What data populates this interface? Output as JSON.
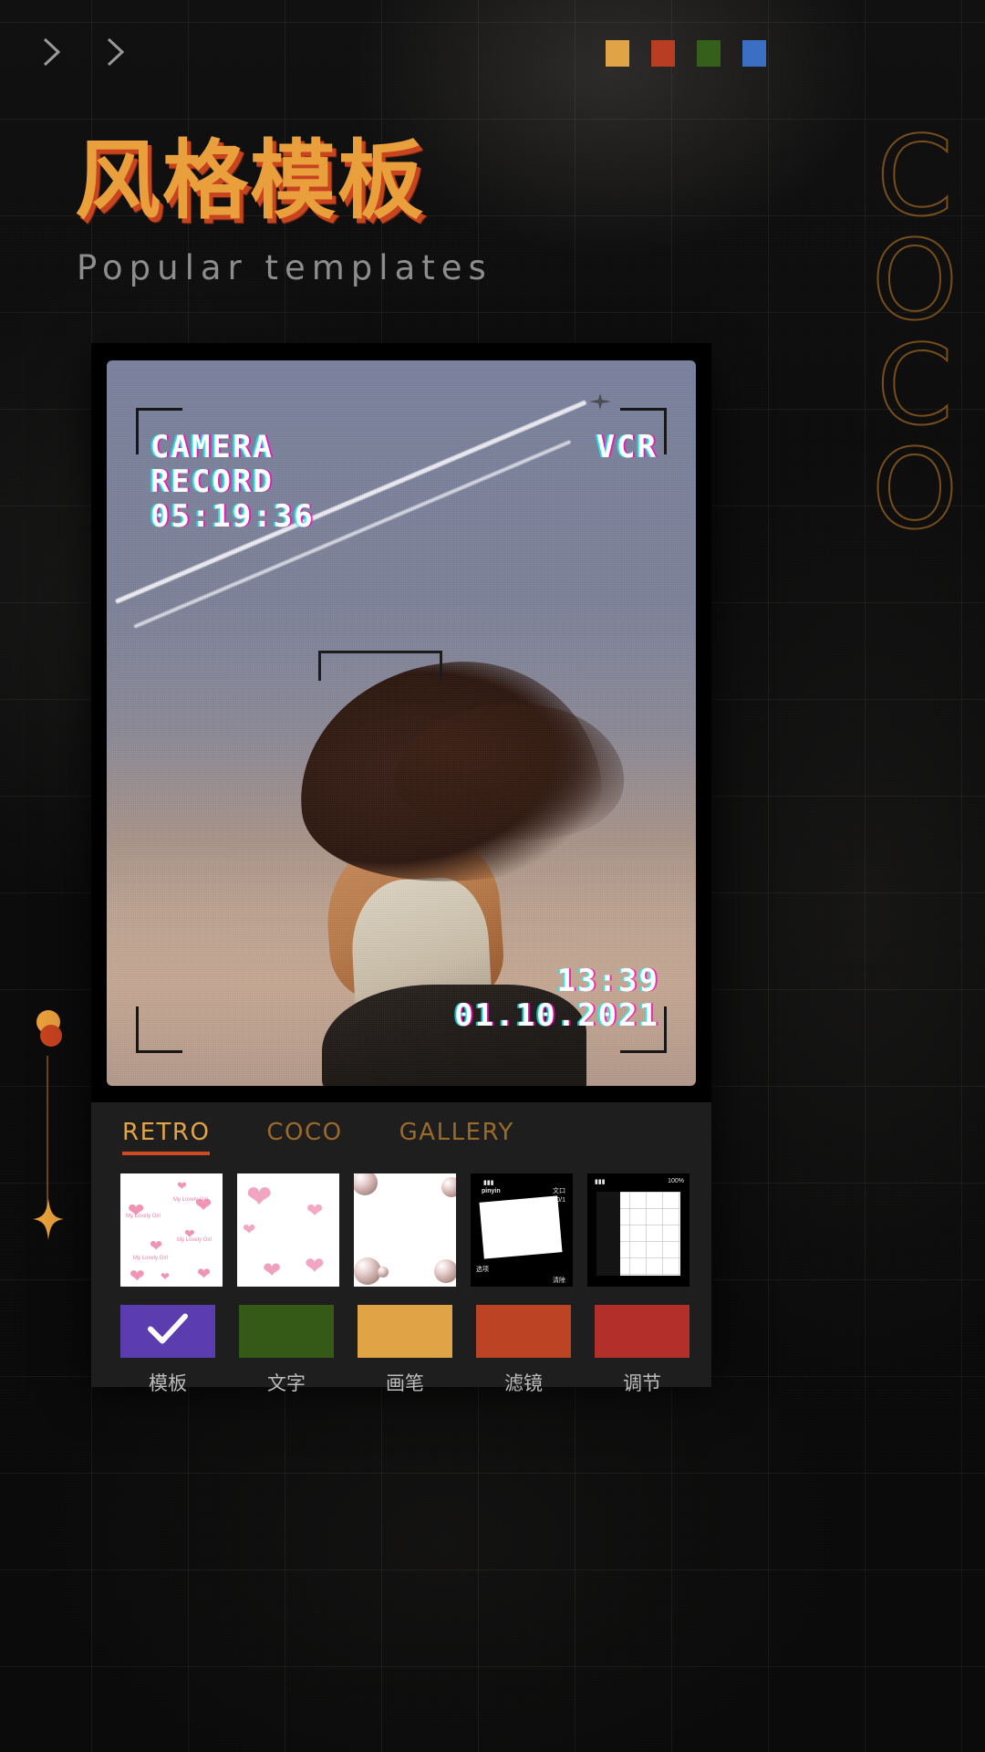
{
  "header": {
    "nav_icons": [
      "chevron-right-icon",
      "chevron-right-icon"
    ],
    "swatches": [
      {
        "name": "swatch-amber",
        "color": "#E0A346"
      },
      {
        "name": "swatch-red",
        "color": "#B93D22"
      },
      {
        "name": "swatch-green",
        "color": "#35601C"
      },
      {
        "name": "swatch-blue",
        "color": "#3B6FC4"
      }
    ]
  },
  "hero": {
    "title_cn": "风格模板",
    "title_en": "Popular templates",
    "title_color": "#E9A03C",
    "title_shadow_color": "#C8441E",
    "side_letters": [
      "C",
      "O",
      "C",
      "O"
    ],
    "side_letters_color": "#8a5a1e"
  },
  "editor": {
    "overlay": {
      "label_camera": "CAMERA",
      "label_record": "RECORD",
      "timecode": "05:19:36",
      "mode": "VCR",
      "clock": "13:39",
      "date": "01.10.2021"
    }
  },
  "tabs": [
    {
      "label": "RETRO",
      "active": true
    },
    {
      "label": "COCO",
      "active": false
    },
    {
      "label": "GALLERY",
      "active": false
    }
  ],
  "tab_colors": {
    "active_text": "#E3A447",
    "inactive_text": "#9A6A2A",
    "underline": "#CF4A22"
  },
  "thumbnails": [
    {
      "name": "template-thumb-hearts-small",
      "kind": "hearts-small",
      "caption": "My Lovely Girl"
    },
    {
      "name": "template-thumb-hearts-large",
      "kind": "hearts-large",
      "caption": ""
    },
    {
      "name": "template-thumb-pearls",
      "kind": "pearls",
      "caption": ""
    },
    {
      "name": "template-thumb-keyboard-dark",
      "kind": "keyboard",
      "caption": "pinyin"
    },
    {
      "name": "template-thumb-phone-ui",
      "kind": "phone-ui",
      "caption": ""
    }
  ],
  "thumb_text": {
    "keyboard_brand": "pinyin",
    "keyboard_count": "890/1",
    "keyboard_left": "选项",
    "keyboard_right": "清除",
    "keyboard_corner": "文口"
  },
  "tools": [
    {
      "label": "模板",
      "color": "#5B3DB0",
      "selected": true,
      "icon": "check-icon"
    },
    {
      "label": "文字",
      "color": "#355A17",
      "selected": false,
      "icon": ""
    },
    {
      "label": "画笔",
      "color": "#E0A346",
      "selected": false,
      "icon": ""
    },
    {
      "label": "滤镜",
      "color": "#BC4324",
      "selected": false,
      "icon": ""
    },
    {
      "label": "调节",
      "color": "#B3302A",
      "selected": false,
      "icon": ""
    }
  ],
  "rail": {
    "dot_amber_color": "#E9A03C",
    "dot_red_color": "#C8431F",
    "line_color": "#7A4A16",
    "sparkle_color": "#E9A03C"
  }
}
